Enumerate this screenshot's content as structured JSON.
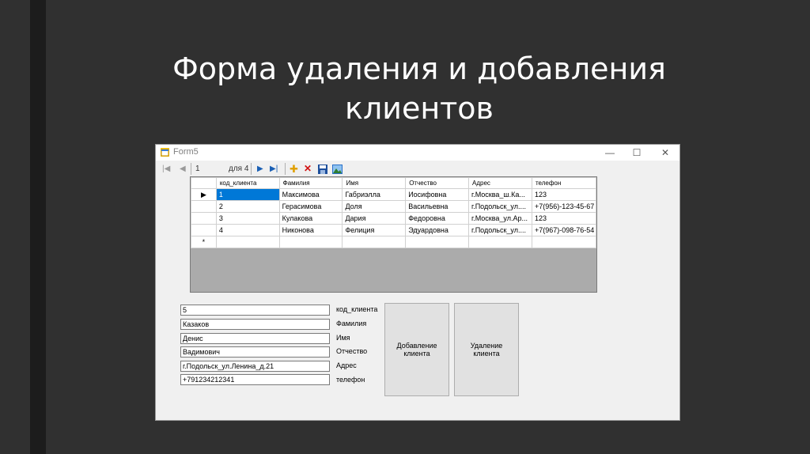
{
  "slide": {
    "title_line1": "Форма удаления и добавления",
    "title_line2": "клиентов"
  },
  "window": {
    "title": "Form5",
    "minimize": "—",
    "maximize": "☐",
    "close": "✕"
  },
  "navigator": {
    "position": "1",
    "count_label": "для 4"
  },
  "grid": {
    "columns": [
      "код_клиента",
      "Фамилия",
      "Имя",
      "Отчество",
      "Адрес",
      "телефон"
    ],
    "rows": [
      {
        "marker": "▶",
        "cells": [
          "1",
          "Максимова",
          "Габриэлла",
          "Иосифовна",
          "г.Москва_ш.Ка...",
          "123"
        ]
      },
      {
        "marker": "",
        "cells": [
          "2",
          "Герасимова",
          "Доля",
          "Васильевна",
          "г.Подольск_ул....",
          "+7(956)-123-45-67"
        ]
      },
      {
        "marker": "",
        "cells": [
          "3",
          "Кулакова",
          "Дария",
          "Федоровна",
          "г.Москва_ул.Ар...",
          "123"
        ]
      },
      {
        "marker": "",
        "cells": [
          "4",
          "Никонова",
          "Фелиция",
          "Эдуардовна",
          "г.Подольск_ул....",
          "+7(967)-098-76-54"
        ]
      },
      {
        "marker": "*",
        "cells": [
          "",
          "",
          "",
          "",
          "",
          ""
        ]
      }
    ]
  },
  "form": {
    "fields": [
      {
        "value": "5",
        "label": "код_клиента"
      },
      {
        "value": "Казаков",
        "label": "Фамилия"
      },
      {
        "value": "Денис",
        "label": "Имя"
      },
      {
        "value": "Вадимович",
        "label": "Отчество"
      },
      {
        "value": "г.Подольск_ул.Ленина_д.21",
        "label": "Адрес"
      },
      {
        "value": "+791234212341",
        "label": "телефон"
      }
    ],
    "add_button_line1": "Добавление",
    "add_button_line2": "клиента",
    "delete_button_line1": "Удаление",
    "delete_button_line2": "клиента"
  }
}
